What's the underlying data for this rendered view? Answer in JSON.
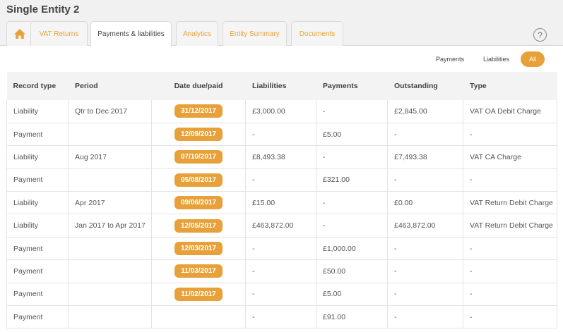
{
  "entity": {
    "title": "Single Entity 2"
  },
  "tabs": [
    {
      "label": "VAT Returns"
    },
    {
      "label": "Payments & liabilities"
    },
    {
      "label": "Analytics"
    },
    {
      "label": "Entity Summary"
    },
    {
      "label": "Documents"
    }
  ],
  "help": {
    "label": "?"
  },
  "filters": [
    {
      "label": "Payments"
    },
    {
      "label": "Liabilities"
    },
    {
      "label": "All"
    }
  ],
  "colors": {
    "accent": "#e8a13a",
    "header_bg": "#f3f3f3",
    "top_bg": "#f1f1f1"
  },
  "icons": {
    "home": "home-icon",
    "help": "help-icon"
  },
  "table": {
    "headers": [
      "Record type",
      "Period",
      "Date due/paid",
      "Liabilities",
      "Payments",
      "Outstanding",
      "Type"
    ],
    "rows": [
      [
        "Liability",
        "Qtr to Dec 2017",
        "31/12/2017",
        "£3,000.00",
        "-",
        "£2,845.00",
        "VAT OA Debit Charge"
      ],
      [
        "Payment",
        "",
        "12/09/2017",
        "-",
        "£5.00",
        "-",
        "-"
      ],
      [
        "Liability",
        "Aug 2017",
        "07/10/2017",
        "£8,493.38",
        "-",
        "£7,493.38",
        "VAT CA Charge"
      ],
      [
        "Payment",
        "",
        "05/08/2017",
        "-",
        "£321.00",
        "-",
        "-"
      ],
      [
        "Liability",
        "Apr 2017",
        "09/06/2017",
        "£15.00",
        "-",
        "£0.00",
        "VAT Return Debit Charge"
      ],
      [
        "Liability",
        "Jan 2017 to Apr 2017",
        "12/05/2017",
        "£463,872.00",
        "-",
        "£463,872.00",
        "VAT Return Debit Charge"
      ],
      [
        "Payment",
        "",
        "12/03/2017",
        "-",
        "£1,000.00",
        "-",
        "-"
      ],
      [
        "Payment",
        "",
        "11/03/2017",
        "-",
        "£50.00",
        "-",
        "-"
      ],
      [
        "Payment",
        "",
        "11/02/2017",
        "-",
        "£5.00",
        "-",
        "-"
      ],
      [
        "Payment",
        "",
        "",
        "-",
        "£91.00",
        "-",
        "-"
      ]
    ]
  }
}
